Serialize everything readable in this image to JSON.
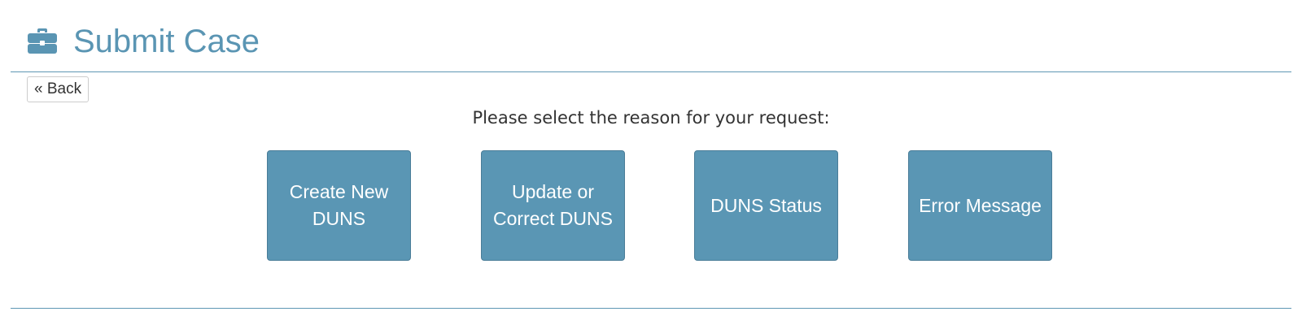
{
  "colors": {
    "accent": "#5a95b3",
    "button": "#5a96b4",
    "rule": "#5e97b4"
  },
  "header": {
    "icon": "briefcase-icon",
    "title": "Submit Case"
  },
  "back": {
    "label": "« Back"
  },
  "prompt": "Please select the reason for your request:",
  "options": [
    {
      "label": "Create New DUNS"
    },
    {
      "label": "Update or Correct DUNS"
    },
    {
      "label": "DUNS Status"
    },
    {
      "label": "Error Message"
    }
  ]
}
